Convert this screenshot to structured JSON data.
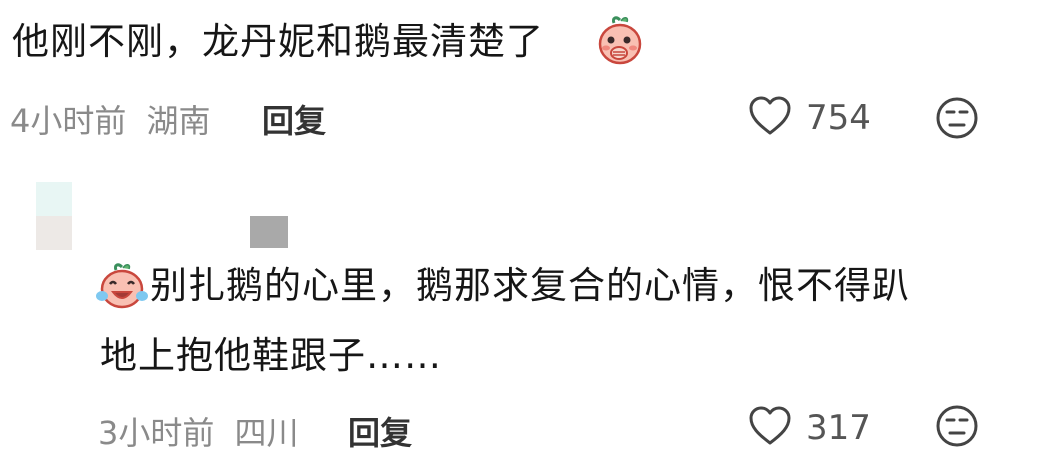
{
  "comment": {
    "text": "他刚不刚，龙丹妮和鹅最清楚了",
    "emoji": "peach-covering-mouth-emoji",
    "time": "4小时前",
    "location": "湖南",
    "reply_label": "回复",
    "like_count": "754",
    "like_icon": "heart-icon",
    "dislike_icon": "neutral-face-icon"
  },
  "reply": {
    "emoji": "peach-laughing-tears-emoji",
    "line1": "别扎鹅的心里，鹅那求复合的心情，恨不得趴",
    "line2": "地上抱他鞋跟子……",
    "time": "3小时前",
    "location": "四川",
    "reply_label": "回复",
    "like_count": "317",
    "like_icon": "heart-icon",
    "dislike_icon": "neutral-face-icon"
  },
  "colors": {
    "text": "#161616",
    "meta": "#8a8a8a",
    "icon": "#444444",
    "peach": "#f7b3a8"
  }
}
